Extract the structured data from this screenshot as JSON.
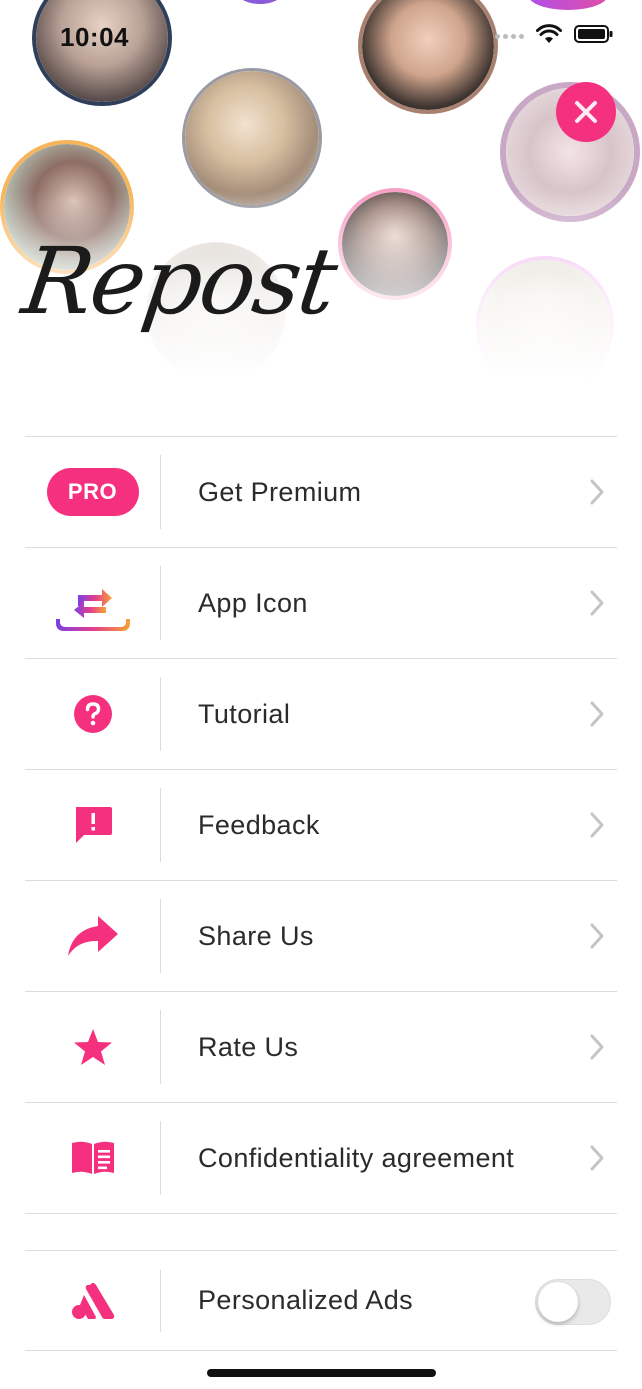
{
  "status_bar": {
    "time": "10:04"
  },
  "header": {
    "logo": "Repost"
  },
  "menu": [
    {
      "id": "premium",
      "label": "Get Premium",
      "badge": "PRO",
      "icon": "pro-badge"
    },
    {
      "id": "app-icon",
      "label": "App Icon",
      "icon": "repost-app-icon"
    },
    {
      "id": "tutorial",
      "label": "Tutorial",
      "icon": "question-icon"
    },
    {
      "id": "feedback",
      "label": "Feedback",
      "icon": "feedback-icon"
    },
    {
      "id": "share",
      "label": "Share Us",
      "icon": "share-arrow-icon"
    },
    {
      "id": "rate",
      "label": "Rate Us",
      "icon": "star-icon"
    },
    {
      "id": "confidentiality",
      "label": "Confidentiality agreement",
      "icon": "book-icon"
    }
  ],
  "settings": [
    {
      "id": "ads",
      "label": "Personalized Ads",
      "icon": "ads-icon",
      "toggle_on": false
    }
  ],
  "colors": {
    "accent": "#f5317f",
    "divider": "#dcdcdc",
    "text": "#2b2b2b"
  }
}
